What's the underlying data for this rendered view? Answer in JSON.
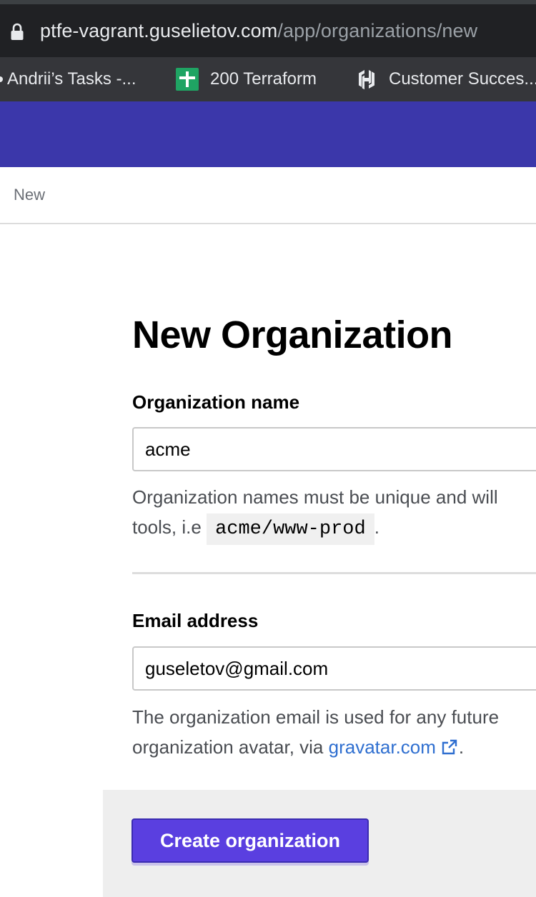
{
  "browser": {
    "url_host": "ptfe-vagrant.guselietov.com",
    "url_path": "/app/organizations/new",
    "bookmarks": [
      {
        "label": "Andrii’s Tasks -...",
        "icon": "bullet-icon"
      },
      {
        "label": "200 Terraform",
        "icon": "sheets-icon"
      },
      {
        "label": "Customer Succes...",
        "icon": "hashicorp-icon"
      }
    ]
  },
  "colors": {
    "header": "#3b37aa",
    "primary_button": "#5a3fe0",
    "link": "#2f6fd0"
  },
  "subnav": {
    "item": "New"
  },
  "form": {
    "title": "New Organization",
    "org_name": {
      "label": "Organization name",
      "value": "acme",
      "help_line1": "Organization names must be unique and will",
      "help_line2_prefix": "tools, i.e ",
      "help_code": "acme/www-prod",
      "help_line2_suffix": "."
    },
    "email": {
      "label": "Email address",
      "value": "guseletov@gmail.com",
      "help_line1": "The organization email is used for any future",
      "help_line2_prefix": "organization avatar, via ",
      "help_link": "gravatar.com",
      "help_line2_suffix": "."
    },
    "submit_label": "Create organization"
  }
}
